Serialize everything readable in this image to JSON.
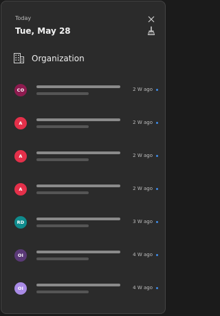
{
  "header": {
    "day_label": "Today",
    "date": "Tue, May 28"
  },
  "section": {
    "title": "Organization",
    "icon": "building-icon"
  },
  "notifications": [
    {
      "initials": "CO",
      "time": "2 W ago",
      "color": "#8d1b4f"
    },
    {
      "initials": "A",
      "time": "2 W ago",
      "color": "#e4304a"
    },
    {
      "initials": "A",
      "time": "2 W ago",
      "color": "#e4304a"
    },
    {
      "initials": "A",
      "time": "2 W ago",
      "color": "#e4304a"
    },
    {
      "initials": "RD",
      "time": "3 W ago",
      "color": "#0f8b8d"
    },
    {
      "initials": "OI",
      "time": "4 W ago",
      "color": "#5a3977"
    },
    {
      "initials": "OI",
      "time": "4 W ago",
      "color": "#a98be6"
    }
  ],
  "colors": {
    "unread_dot": "#3f8be6",
    "panel_bg": "#2b2b2b"
  }
}
